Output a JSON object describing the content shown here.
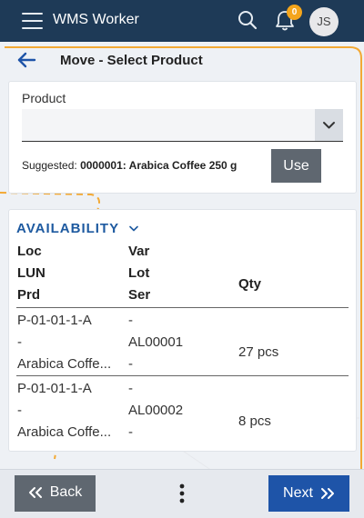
{
  "header": {
    "app_title": "WMS Worker",
    "notification_count": "0",
    "user_initials": "JS"
  },
  "page": {
    "title": "Move - Select Product"
  },
  "product_form": {
    "label": "Product",
    "value": "",
    "placeholder": "",
    "suggested_prefix": "Suggested:",
    "suggested_value": "0000001: Arabica Coffee 250 g",
    "use_label": "Use"
  },
  "availability": {
    "title": "AVAILABILITY",
    "headers": {
      "loc": "Loc",
      "lun": "LUN",
      "prd": "Prd",
      "var": "Var",
      "lot": "Lot",
      "ser": "Ser",
      "qty": "Qty"
    },
    "rows": [
      {
        "loc": "P-01-01-1-A",
        "lun": "-",
        "prd": "Arabica Coffe...",
        "var": "-",
        "lot": "AL00001",
        "ser": "-",
        "qty": "27 pcs"
      },
      {
        "loc": "P-01-01-1-A",
        "lun": "-",
        "prd": "Arabica Coffe...",
        "var": "-",
        "lot": "AL00002",
        "ser": "-",
        "qty": "8 pcs"
      }
    ]
  },
  "footer": {
    "back_label": "Back",
    "next_label": "Next"
  },
  "colors": {
    "topbar": "#1e3a57",
    "accent_blue": "#1e54a8",
    "badge": "#f4a51c",
    "neutral_button": "#5f6770",
    "background_art": "#f3a934"
  }
}
